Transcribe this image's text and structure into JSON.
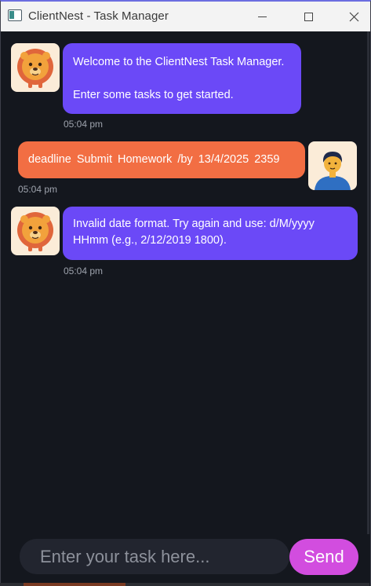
{
  "window": {
    "title": "ClientNest - Task Manager"
  },
  "messages": [
    {
      "sender": "bot",
      "avatar": "lion-icon",
      "lines": [
        "Welcome to the ClientNest Task Manager.",
        "",
        "Enter some tasks to get started."
      ],
      "time": "05:04 pm"
    },
    {
      "sender": "user",
      "avatar": "person-icon",
      "text": "deadline Submit Homework /by 13/4/2025 2359",
      "time": "05:04 pm"
    },
    {
      "sender": "bot",
      "avatar": "lion-icon",
      "text": "Invalid date format. Try again and use: d/M/yyyy HHmm (e.g., 2/12/2019 1800).",
      "time": "05:04 pm"
    }
  ],
  "input": {
    "placeholder": "Enter your task here...",
    "value": ""
  },
  "send_label": "Send",
  "colors": {
    "bot_bubble": "#6b49f7",
    "user_bubble": "#f26e43",
    "send_button": "#d24ddf",
    "background": "#14171e"
  }
}
